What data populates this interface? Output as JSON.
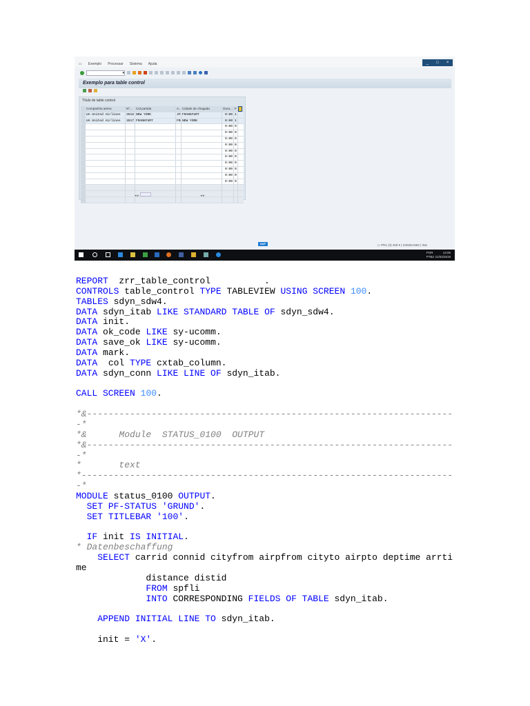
{
  "screenshot": {
    "menu": [
      "Exemplo",
      "Processar",
      "Sistema",
      "Ajuda"
    ],
    "window_buttons": [
      "_",
      "□",
      "×"
    ],
    "title": "Exemplo para table control",
    "table_title": "Título de table control",
    "columns": [
      "Companhia aérea",
      "Nº...",
      "Cid.partida",
      "A...",
      "Cidade de chegada",
      "Dura...",
      "F"
    ],
    "rows": [
      [
        "UA United Airlines",
        "3516",
        "NEW YORK",
        "JFK",
        "FRANKFURT",
        "0:00",
        "1"
      ],
      [
        "UA United Airlines",
        "3517",
        "FRANKFURT",
        "FRA",
        "NEW YORK",
        "0:00",
        "1"
      ]
    ],
    "empty_duration": "0:00",
    "empty_flag": "0",
    "empty_rows": 10,
    "status_system": "PR1 (3) 400",
    "status_server": "S402DA583",
    "status_mode": "INS",
    "sap_logo": "SAP",
    "tray_lang": "POR\nPTB2",
    "tray_time": "14:05",
    "tray_date": "21/02/2019"
  },
  "code": [
    [
      [
        "REPORT",
        "k"
      ],
      [
        "  zrr_table_control          .",
        "t"
      ]
    ],
    [
      [
        "CONTROLS",
        "k"
      ],
      [
        " table_control ",
        "t"
      ],
      [
        "TYPE",
        "k"
      ],
      [
        " TABLEVIEW ",
        "t"
      ],
      [
        "USING SCREEN",
        "k"
      ],
      [
        " ",
        "t"
      ],
      [
        "100",
        "n"
      ],
      [
        ".",
        "t"
      ]
    ],
    [
      [
        "TABLES",
        "k"
      ],
      [
        " sdyn_sdw4.",
        "t"
      ]
    ],
    [
      [
        "DATA",
        "k"
      ],
      [
        " sdyn_itab ",
        "t"
      ],
      [
        "LIKE STANDARD TABLE OF",
        "k"
      ],
      [
        " sdyn_sdw4.",
        "t"
      ]
    ],
    [
      [
        "DATA",
        "k"
      ],
      [
        " init.",
        "t"
      ]
    ],
    [
      [
        "DATA",
        "k"
      ],
      [
        " ok_code ",
        "t"
      ],
      [
        "LIKE",
        "k"
      ],
      [
        " sy-ucomm.",
        "t"
      ]
    ],
    [
      [
        "DATA",
        "k"
      ],
      [
        " save_ok ",
        "t"
      ],
      [
        "LIKE",
        "k"
      ],
      [
        " sy-ucomm.",
        "t"
      ]
    ],
    [
      [
        "DATA",
        "k"
      ],
      [
        " mark.",
        "t"
      ]
    ],
    [
      [
        "DATA",
        "k"
      ],
      [
        "  col ",
        "t"
      ],
      [
        "TYPE",
        "k"
      ],
      [
        " cxtab_column.",
        "t"
      ]
    ],
    [
      [
        "DATA",
        "k"
      ],
      [
        " sdyn_conn ",
        "t"
      ],
      [
        "LIKE LINE OF",
        "k"
      ],
      [
        " sdyn_itab.",
        "t"
      ]
    ],
    [],
    [
      [
        "CALL SCREEN",
        "k"
      ],
      [
        " ",
        "t"
      ],
      [
        "100",
        "n"
      ],
      [
        ".",
        "t"
      ]
    ],
    [],
    [
      [
        "*&--------------------------------------------------------------------",
        "c"
      ]
    ],
    [
      [
        "-*",
        "c"
      ]
    ],
    [
      [
        "*&      Module  STATUS_0100  OUTPUT",
        "c"
      ]
    ],
    [
      [
        "*&--------------------------------------------------------------------",
        "c"
      ]
    ],
    [
      [
        "-*",
        "c"
      ]
    ],
    [
      [
        "*       text",
        "c"
      ]
    ],
    [
      [
        "*---------------------------------------------------------------------",
        "c"
      ]
    ],
    [
      [
        "-*",
        "c"
      ]
    ],
    [
      [
        "MODULE",
        "k"
      ],
      [
        " status_0100 ",
        "t"
      ],
      [
        "OUTPUT",
        "k"
      ],
      [
        ".",
        "t"
      ]
    ],
    [
      [
        "  ",
        "t"
      ],
      [
        "SET PF-STATUS",
        "k"
      ],
      [
        " ",
        "t"
      ],
      [
        "'GRUND'",
        "s"
      ],
      [
        ".",
        "t"
      ]
    ],
    [
      [
        "  ",
        "t"
      ],
      [
        "SET TITLEBAR",
        "k"
      ],
      [
        " ",
        "t"
      ],
      [
        "'100'",
        "s"
      ],
      [
        ".",
        "t"
      ]
    ],
    [],
    [
      [
        "  ",
        "t"
      ],
      [
        "IF",
        "k"
      ],
      [
        " init ",
        "t"
      ],
      [
        "IS INITIAL",
        "k"
      ],
      [
        ".",
        "t"
      ]
    ],
    [
      [
        "* Datenbeschaffung",
        "c"
      ]
    ],
    [
      [
        "    ",
        "t"
      ],
      [
        "SELECT",
        "k"
      ],
      [
        " carrid connid cityfrom airpfrom cityto airpto deptime arrti",
        "t"
      ]
    ],
    [
      [
        "me",
        "t"
      ]
    ],
    [
      [
        "             distance distid",
        "t"
      ]
    ],
    [
      [
        "             ",
        "t"
      ],
      [
        "FROM",
        "k"
      ],
      [
        " spfli",
        "t"
      ]
    ],
    [
      [
        "             ",
        "t"
      ],
      [
        "INTO",
        "k"
      ],
      [
        " CORRESPONDING ",
        "t"
      ],
      [
        "FIELDS OF TABLE",
        "k"
      ],
      [
        " sdyn_itab.",
        "t"
      ]
    ],
    [],
    [
      [
        "    ",
        "t"
      ],
      [
        "APPEND INITIAL LINE TO",
        "k"
      ],
      [
        " sdyn_itab.",
        "t"
      ]
    ],
    [],
    [
      [
        "    init = ",
        "t"
      ],
      [
        "'X'",
        "s"
      ],
      [
        ".",
        "t"
      ]
    ]
  ]
}
